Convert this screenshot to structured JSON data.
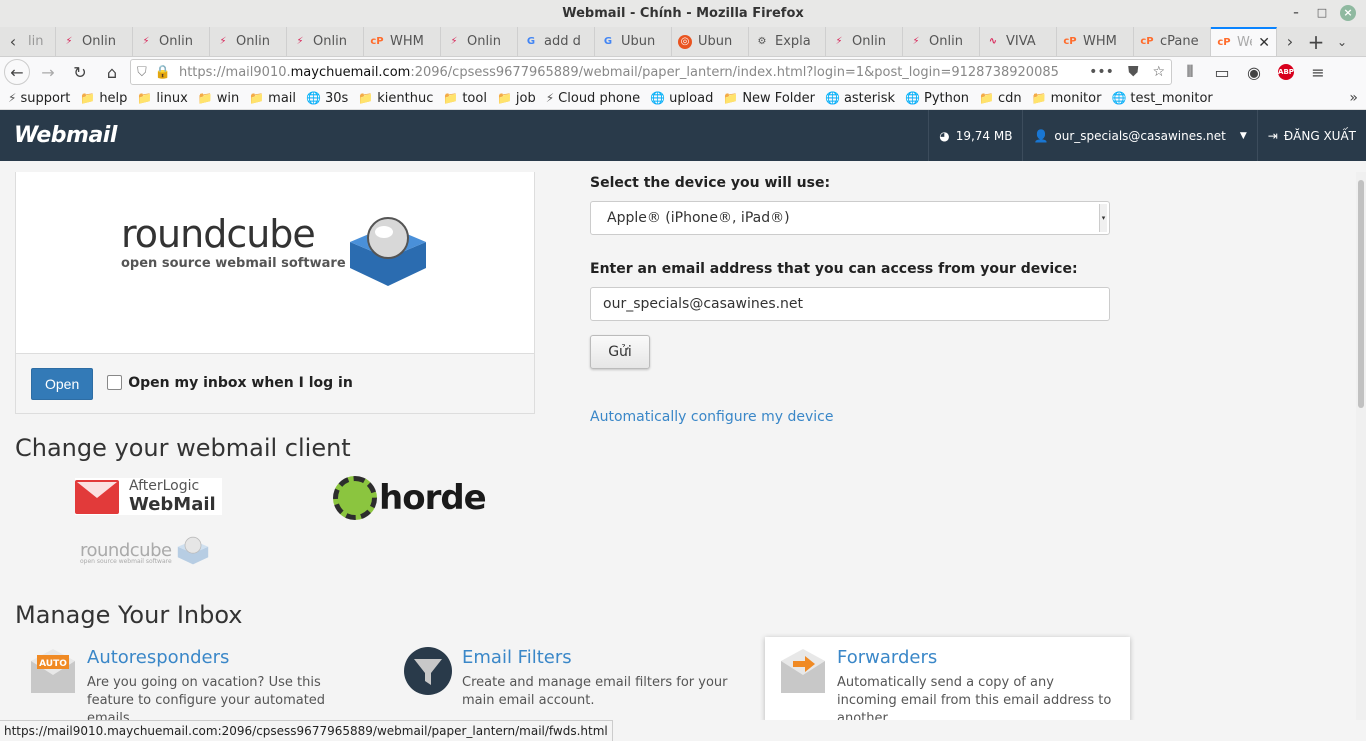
{
  "window": {
    "title": "Webmail - Chính - Mozilla Firefox"
  },
  "tabs": [
    {
      "label": "Onlin",
      "icon": "online-icon"
    },
    {
      "label": "Onlin",
      "icon": "online-icon"
    },
    {
      "label": "Onlin",
      "icon": "online-icon"
    },
    {
      "label": "Onlin",
      "icon": "online-icon"
    },
    {
      "label": "WHM",
      "icon": "cpanel-icon"
    },
    {
      "label": "Onlin",
      "icon": "online-icon"
    },
    {
      "label": "add d",
      "icon": "google-icon"
    },
    {
      "label": "Ubun",
      "icon": "google-icon"
    },
    {
      "label": "Ubun",
      "icon": "ubuntu-icon"
    },
    {
      "label": "Expla",
      "icon": "gear-icon"
    },
    {
      "label": "Onlin",
      "icon": "online-icon"
    },
    {
      "label": "Onlin",
      "icon": "online-icon"
    },
    {
      "label": "VIVA",
      "icon": "viva-icon"
    },
    {
      "label": "WHM",
      "icon": "cpanel-icon"
    },
    {
      "label": "cPane",
      "icon": "cpanel-icon"
    }
  ],
  "active_tab": {
    "label": "We"
  },
  "first_tab_partial": "lin",
  "url": {
    "prefix": "https://mail9010.",
    "host": "maychuemail.com",
    "rest": ":2096/cpsess9677965889/webmail/paper_lantern/index.html?login=1&post_login=9128738920085"
  },
  "bookmarks": [
    "support",
    "help",
    "linux",
    "win",
    "mail",
    "30s",
    "kienthuc",
    "tool",
    "job",
    "Cloud phone",
    "upload",
    "New Folder",
    "asterisk",
    "Python",
    "cdn",
    "monitor",
    "test_monitor"
  ],
  "appbar": {
    "logo": "Webmail",
    "disk_usage": "19,74 MB",
    "user": "our_specials@casawines.net",
    "logout": "ĐĂNG XUẤT"
  },
  "roundcube": {
    "logo_text": "roundcube",
    "logo_sub": "open source webmail software",
    "open_button": "Open",
    "checkbox_label": "Open my inbox when I log in"
  },
  "device": {
    "select_label": "Select the device you will use:",
    "select_value": "Apple® (iPhone®, iPad®)",
    "email_label": "Enter an email address that you can access from your device:",
    "email_value": "our_specials@casawines.net",
    "send_button": "Gửi",
    "auto_config_link": "Automatically configure my device"
  },
  "clients": {
    "heading": "Change your webmail client",
    "afterlogic_line1": "AfterLogic",
    "afterlogic_line2": "WebMail",
    "horde": "horde",
    "roundcube": "roundcube",
    "roundcube_sub": "open source webmail software"
  },
  "inbox": {
    "heading": "Manage Your Inbox",
    "tiles": [
      {
        "title": "Autoresponders",
        "desc": "Are you going on vacation? Use this feature to configure your automated emails.",
        "badge": "AUTO"
      },
      {
        "title": "Email Filters",
        "desc": "Create and manage email filters for your main email account."
      },
      {
        "title": "Forwarders",
        "desc": "Automatically send a copy of any incoming email from this email address to another."
      }
    ]
  },
  "status_url": "https://mail9010.maychuemail.com:2096/cpsess9677965889/webmail/paper_lantern/mail/fwds.html"
}
